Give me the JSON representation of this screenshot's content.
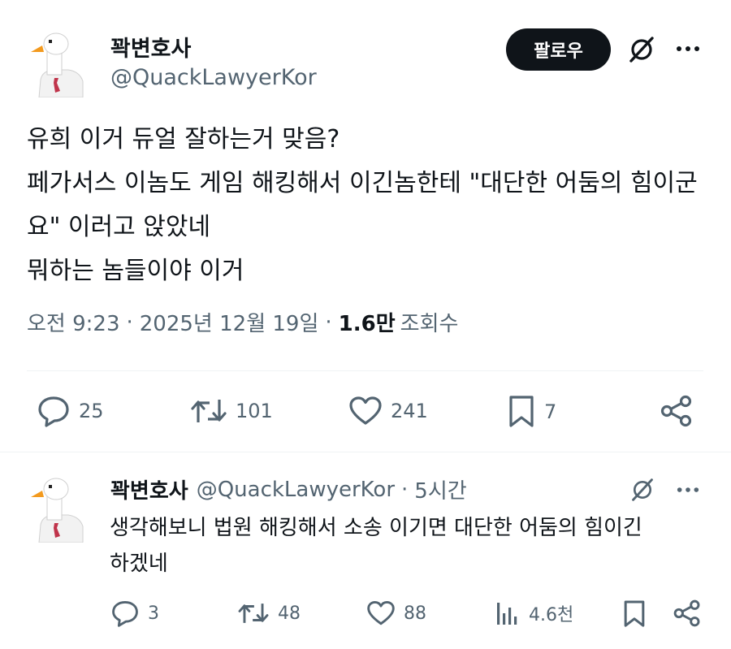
{
  "tweet": {
    "display_name": "꽉변호사",
    "handle": "@QuackLawyerKor",
    "follow_label": "팔로우",
    "text": "유희 이거 듀얼 잘하는거 맞음?\n페가서스 이놈도 게임 해킹해서 이긴놈한테 \"대단한 어둠의 힘이군요\" 이러고 앉았네\n뭐하는 놈들이야 이거",
    "time": "오전 9:23",
    "separator": "·",
    "date": "2025년 12월 19일",
    "views_count": "1.6만",
    "views_label": "조회수",
    "actions": {
      "replies": "25",
      "retweets": "101",
      "likes": "241",
      "bookmarks": "7"
    }
  },
  "reply": {
    "display_name": "꽉변호사",
    "handle": "@QuackLawyerKor",
    "separator": "·",
    "time_ago": "5시간",
    "text": "생각해보니 법원 해킹해서 소송 이기면 대단한 어둠의 힘이긴\n하겠네",
    "actions": {
      "replies": "3",
      "retweets": "48",
      "likes": "88",
      "views": "4.6천"
    }
  },
  "icons": {
    "avatar": "goose-avatar-icon",
    "grok": "grok-icon",
    "more": "more-icon",
    "reply": "reply-icon",
    "retweet": "retweet-icon",
    "like": "heart-icon",
    "bookmark": "bookmark-icon",
    "share": "share-icon",
    "views": "views-icon"
  },
  "colors": {
    "text": "#0f1419",
    "secondary": "#536471",
    "follow_bg": "#0f1419"
  }
}
